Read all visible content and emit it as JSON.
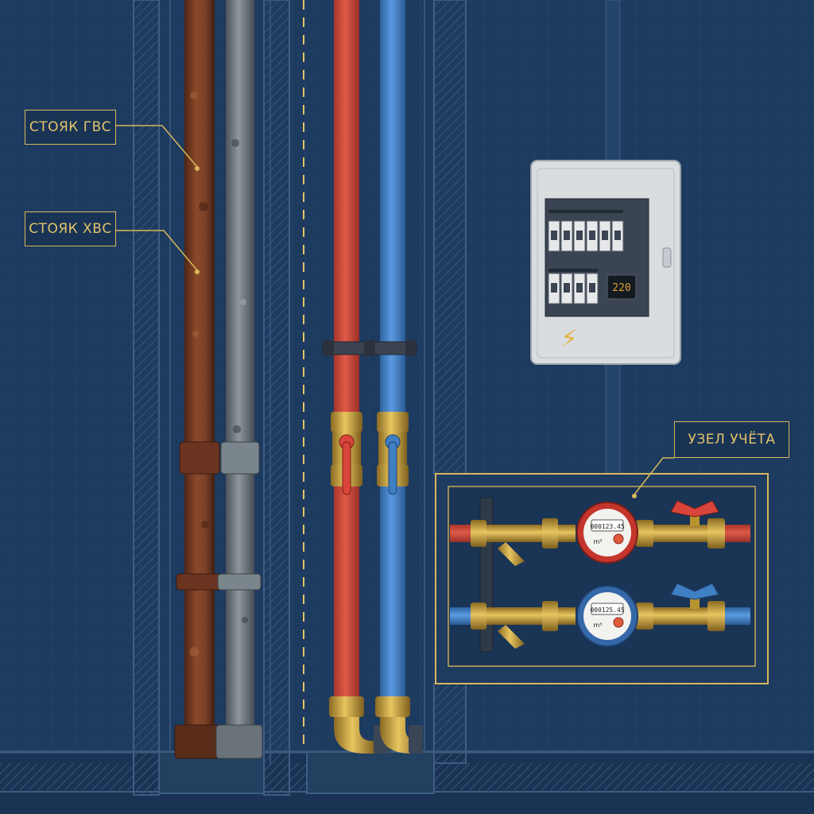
{
  "labels": {
    "hot_riser": "СТОЯК ГВС",
    "cold_riser": "СТОЯК ХВС",
    "meter_node": "УЗЕЛ УЧЁТА"
  },
  "panel": {
    "display_value": "220",
    "hazard_symbol": "⚡"
  },
  "meters": {
    "hot": {
      "reading": "000123.45",
      "unit": "m³"
    },
    "cold": {
      "reading": "000125.45",
      "unit": "m³"
    }
  },
  "colors": {
    "background": "#1d3a5f",
    "hot_pipe": "#c9453a",
    "cold_pipe": "#3f7fc4",
    "rusty_pipe": "#6e3a22",
    "steel_pipe": "#6f7a82",
    "brass": "#c9a23f",
    "callout": "#d8b85a",
    "panel": "#d9dde0",
    "lcd_text": "#e0a030"
  },
  "icons": {
    "lightning": "lightning-icon",
    "hot_valve": "red-valve-handle-icon",
    "cold_valve": "blue-valve-handle-icon"
  }
}
